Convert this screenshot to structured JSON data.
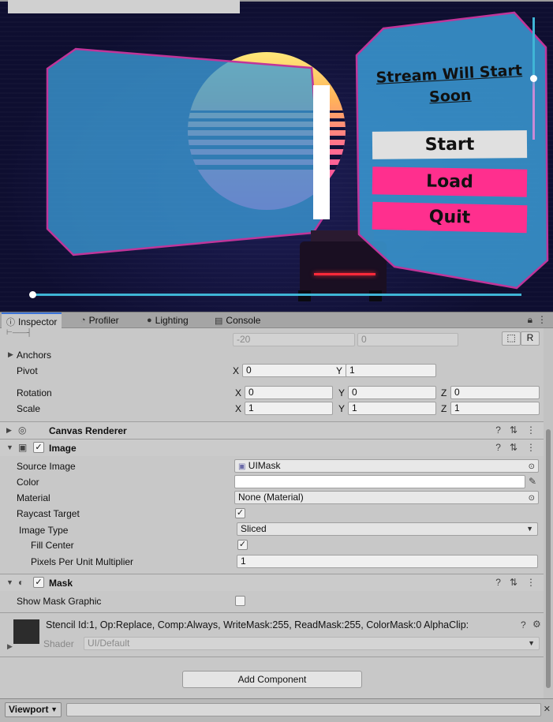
{
  "game": {
    "menu_title_line1": "Stream Will Start",
    "menu_title_line2": "Soon",
    "buttons": {
      "start": "Start",
      "load": "Load",
      "quit": "Quit"
    },
    "colors": {
      "panel": "#3b9bd6",
      "panel_border": "#c0359a",
      "button_pink": "#ff2f8e",
      "slider": "#3fb5d6"
    }
  },
  "tabs": [
    {
      "label": "Inspector",
      "icon": "info-icon"
    },
    {
      "label": "Profiler",
      "icon": "profiler-icon"
    },
    {
      "label": "Lighting",
      "icon": "bulb-icon"
    },
    {
      "label": "Console",
      "icon": "console-icon"
    }
  ],
  "rect": {
    "delta_x": "-20",
    "delta_y": "0",
    "btn_r": "R"
  },
  "transform": {
    "anchors_label": "Anchors",
    "pivot_label": "Pivot",
    "pivot_x": "0",
    "pivot_y": "1",
    "rotation_label": "Rotation",
    "rot_x": "0",
    "rot_y": "0",
    "rot_z": "0",
    "scale_label": "Scale",
    "scale_x": "1",
    "scale_y": "1",
    "scale_z": "1",
    "axis_x": "X",
    "axis_y": "Y",
    "axis_z": "Z"
  },
  "canvas_renderer": {
    "title": "Canvas Renderer"
  },
  "image": {
    "title": "Image",
    "source_image_label": "Source Image",
    "source_image_value": "UIMask",
    "color_label": "Color",
    "material_label": "Material",
    "material_value": "None (Material)",
    "raycast_label": "Raycast Target",
    "image_type_label": "Image Type",
    "image_type_value": "Sliced",
    "fill_center_label": "Fill Center",
    "ppu_label": "Pixels Per Unit Multiplier",
    "ppu_value": "1"
  },
  "mask": {
    "title": "Mask",
    "show_graphic_label": "Show Mask Graphic"
  },
  "shader": {
    "info": "Stencil Id:1, Op:Replace, Comp:Always, WriteMask:255, ReadMask:255, ColorMask:0 AlphaClip:",
    "label": "Shader",
    "value": "UI/Default"
  },
  "add_component_label": "Add Component",
  "bottom": {
    "viewport_label": "Viewport"
  }
}
